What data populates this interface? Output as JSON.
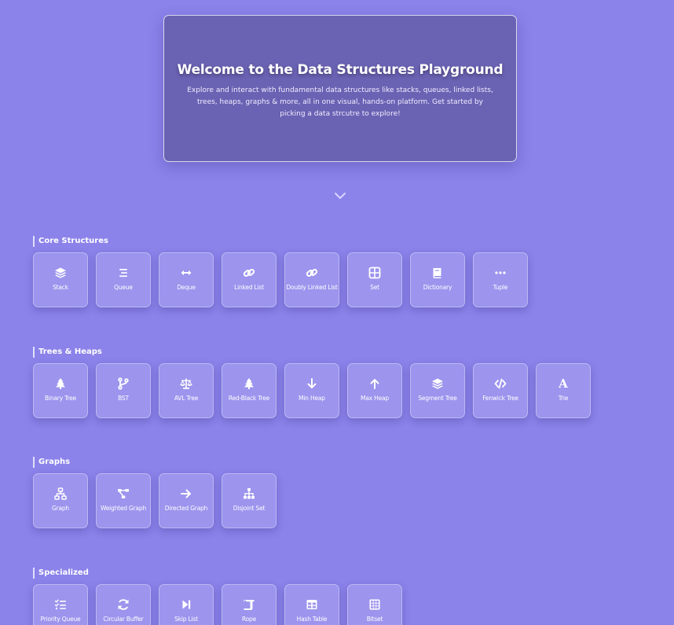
{
  "hero": {
    "title": "Welcome to the Data Structures Playground",
    "description": "Explore and interact with fundamental data structures like stacks, queues, linked lists, trees, heaps, graphs & more, all in one visual, hands-on platform. Get started by picking a data strcutre to explore!"
  },
  "sections": [
    {
      "title": "Core Structures",
      "items": [
        {
          "label": "Stack",
          "icon": "layers-icon"
        },
        {
          "label": "Queue",
          "icon": "bars-icon"
        },
        {
          "label": "Deque",
          "icon": "arrows-left-right-icon"
        },
        {
          "label": "Linked List",
          "icon": "link-icon"
        },
        {
          "label": "Doubly Linked List",
          "icon": "link-icon"
        },
        {
          "label": "Set",
          "icon": "grid-icon"
        },
        {
          "label": "Dictionary",
          "icon": "book-icon"
        },
        {
          "label": "Tuple",
          "icon": "ellipsis-icon"
        }
      ]
    },
    {
      "title": "Trees & Heaps",
      "items": [
        {
          "label": "Binary Tree",
          "icon": "tree-icon"
        },
        {
          "label": "BST",
          "icon": "code-branch-icon"
        },
        {
          "label": "AVL Tree",
          "icon": "balance-scale-icon"
        },
        {
          "label": "Red-Black Tree",
          "icon": "tree-icon"
        },
        {
          "label": "Min Heap",
          "icon": "arrow-down-icon"
        },
        {
          "label": "Max Heap",
          "icon": "arrow-up-icon"
        },
        {
          "label": "Segment Tree",
          "icon": "layers-icon"
        },
        {
          "label": "Fenwick Tree",
          "icon": "code-icon"
        },
        {
          "label": "Trie",
          "icon": "font-icon"
        }
      ]
    },
    {
      "title": "Graphs",
      "items": [
        {
          "label": "Graph",
          "icon": "network-icon"
        },
        {
          "label": "Weighted Graph",
          "icon": "project-diagram-icon"
        },
        {
          "label": "Directed Graph",
          "icon": "arrow-right-icon"
        },
        {
          "label": "Disjoint Set",
          "icon": "sitemap-icon"
        }
      ]
    },
    {
      "title": "Specialized",
      "items": [
        {
          "label": "Priority Queue",
          "icon": "list-check-icon"
        },
        {
          "label": "Circular Buffer",
          "icon": "sync-icon"
        },
        {
          "label": "Skip List",
          "icon": "step-forward-icon"
        },
        {
          "label": "Rope",
          "icon": "scroll-icon"
        },
        {
          "label": "Hash Table",
          "icon": "table-icon"
        },
        {
          "label": "Bitset",
          "icon": "table-cells-icon"
        }
      ]
    }
  ],
  "colors": {
    "background": "#8b82ea",
    "hero": "#6a62b3",
    "text": "#ffffff"
  }
}
